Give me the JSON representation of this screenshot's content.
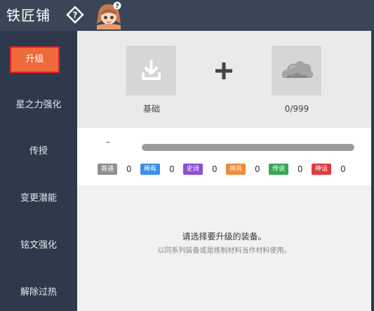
{
  "header": {
    "title": "铁匠铺"
  },
  "sidebar": {
    "items": [
      {
        "label": "升级",
        "active": true
      },
      {
        "label": "星之力强化"
      },
      {
        "label": "传授"
      },
      {
        "label": "变更潜能"
      },
      {
        "label": "铭文强化"
      },
      {
        "label": "解除过热"
      }
    ]
  },
  "upgrade": {
    "base_label": "基础",
    "material_count": "0/999"
  },
  "stats": {
    "dash": "–",
    "progress": 1.0,
    "rarities": [
      {
        "label": "普通",
        "count": "0",
        "color": "#8f8f8f"
      },
      {
        "label": "稀有",
        "count": "0",
        "color": "#3a8ee6"
      },
      {
        "label": "史诗",
        "count": "0",
        "color": "#8c4fd6"
      },
      {
        "label": "神兵",
        "count": "0",
        "color": "#f08a3c"
      },
      {
        "label": "传说",
        "count": "0",
        "color": "#3aa654"
      },
      {
        "label": "神话",
        "count": "0",
        "color": "#e03a3a"
      }
    ]
  },
  "empty_state": {
    "message": "请选择要升级的装备。",
    "hint": "以同系列装备或是炼制材料当作材料使用。"
  },
  "icons": {
    "help": "help-diamond-icon",
    "download": "download-icon",
    "plus": "plus-icon",
    "material": "cloud-ore-icon"
  }
}
